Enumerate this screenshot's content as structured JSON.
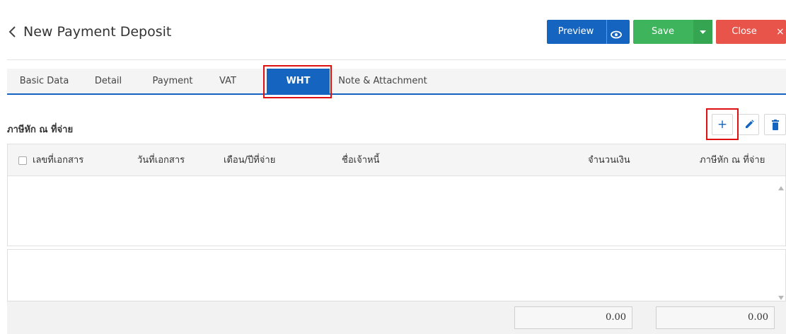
{
  "header": {
    "title": "New Payment Deposit",
    "preview_label": "Preview",
    "save_label": "Save",
    "close_label": "Close",
    "close_x": "×"
  },
  "tabs": [
    {
      "label": "Basic Data"
    },
    {
      "label": "Detail"
    },
    {
      "label": "Payment"
    },
    {
      "label": "VAT"
    },
    {
      "label": "WHT",
      "active": true
    },
    {
      "label": "Note & Attachment"
    }
  ],
  "section": {
    "title": "ภาษีหัก ณ ที่จ่าย",
    "add_symbol": "+"
  },
  "table": {
    "columns": [
      "เลขที่เอกสาร",
      "วันที่เอกสาร",
      "เดือน/ปีที่จ่าย",
      "ชื่อเจ้าหนี้",
      "จำนวนเงิน",
      "ภาษีหัก ณ ที่จ่าย"
    ],
    "rows": []
  },
  "footer": {
    "total_amount": "0.00",
    "total_wht": "0.00"
  },
  "colors": {
    "primary": "#1565c0",
    "save": "#3eb45c",
    "close": "#e8534a",
    "highlight": "#dd1111"
  },
  "icons": [
    "chevron-left-icon",
    "eye-icon",
    "caret-down-icon",
    "plus-icon",
    "pencil-icon",
    "trash-icon",
    "scroll-up-icon",
    "scroll-down-icon"
  ]
}
